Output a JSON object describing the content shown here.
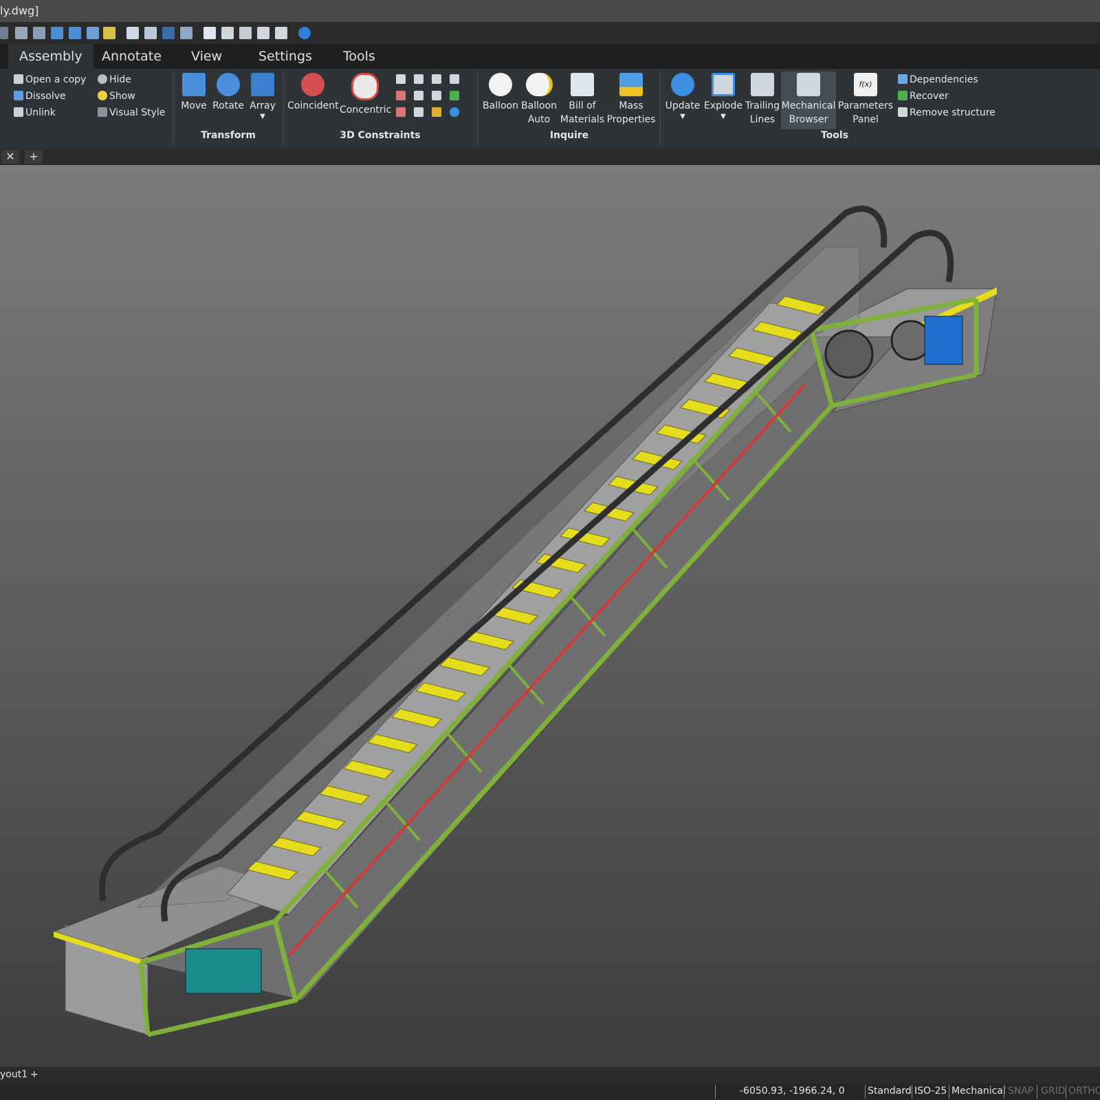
{
  "window": {
    "title": "ly.dwg]"
  },
  "ribbon_tabs": [
    "Assembly",
    "Annotate",
    "View",
    "Settings",
    "Tools"
  ],
  "active_tab": "Assembly",
  "left_panel": {
    "col1": [
      "Open a copy",
      "Dissolve",
      "Unlink"
    ],
    "col2": [
      "Hide",
      "Show",
      "Visual Style"
    ]
  },
  "transform": {
    "label": "Transform",
    "buttons": [
      "Move",
      "Rotate",
      "Array"
    ]
  },
  "constraints": {
    "label": "3D Constraints",
    "buttons": [
      "Coincident",
      "Concentric"
    ]
  },
  "inquire": {
    "label": "Inquire",
    "buttons": [
      {
        "line1": "Balloon",
        "line2": ""
      },
      {
        "line1": "Balloon",
        "line2": "Auto"
      },
      {
        "line1": "Bill of",
        "line2": "Materials"
      },
      {
        "line1": "Mass",
        "line2": "Properties"
      }
    ]
  },
  "tools": {
    "label": "Tools",
    "buttons": [
      {
        "line1": "Update",
        "line2": ""
      },
      {
        "line1": "Explode",
        "line2": ""
      },
      {
        "line1": "Trailing",
        "line2": "Lines"
      },
      {
        "line1": "Mechanical",
        "line2": "Browser"
      },
      {
        "line1": "Parameters",
        "line2": "Panel"
      }
    ],
    "small": [
      "Dependencies",
      "Recover",
      "Remove structure"
    ]
  },
  "layout_tab": "yout1",
  "status": {
    "coords": "-6050.93, -1966.24, 0",
    "items": [
      "Standard",
      "ISO-25",
      "Mechanical"
    ],
    "toggles": [
      "SNAP",
      "GRID",
      "ORTHO"
    ]
  },
  "colors": {
    "frame": "#7fb03a",
    "steps": "#e6dc1e",
    "handrail": "#2e2e2e",
    "motor": "#1f6fd0",
    "gear": "#1a8a8a"
  }
}
